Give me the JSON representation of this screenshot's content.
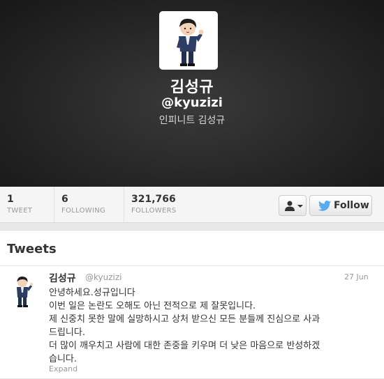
{
  "profile": {
    "name": "김성규",
    "screen_name": "@kyuzizi",
    "bio": "인피니트 김성규"
  },
  "stats": {
    "tweets": {
      "value": "1",
      "label": "TWEET"
    },
    "following": {
      "value": "6",
      "label": "FOLLOWING"
    },
    "followers": {
      "value": "321,766",
      "label": "FOLLOWERS"
    }
  },
  "actions": {
    "follow_label": "Follow",
    "user_menu_icon": "person-icon",
    "follow_icon": "twitter-bird-icon"
  },
  "timeline": {
    "heading": "Tweets",
    "tweet": {
      "name": "김성규",
      "handle": "@kyuzizi",
      "time": "27 Jun",
      "lines": [
        "안녕하세요.성규입니다",
        "이번 일은 논란도 오해도 아닌 전적으로 제 잘못입니다.",
        "제 신중치 못한 말에 실망하시고 상처 받으신 모든 분들께 진심으로 사과",
        "드립니다.",
        "더 많이 깨우치고 사람에 대한 존중을 키우며 더 낮은 마음으로 반성하겠",
        "습니다."
      ],
      "expand_label": "Expand"
    }
  },
  "colors": {
    "header_dark": "#262626",
    "twitter_blue": "#55acee",
    "muted_text": "#999999"
  }
}
